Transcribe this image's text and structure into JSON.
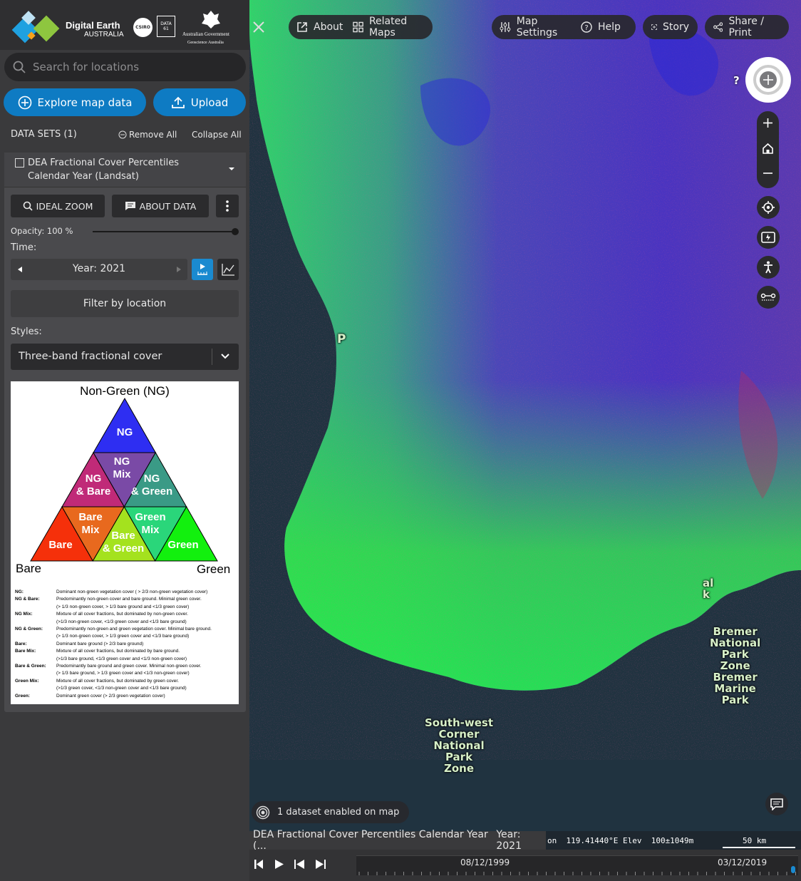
{
  "brand": {
    "name_line1": "Digital Earth",
    "name_line2": "AUSTRALIA",
    "csiro": "CSIRO",
    "data61": "DATA 61",
    "gov_line1": "Australian Government",
    "gov_line2": "Geoscience Australia"
  },
  "search": {
    "placeholder": "Search for locations"
  },
  "actions": {
    "explore": "Explore map data",
    "upload": "Upload"
  },
  "datasets_header": {
    "title": "DATA SETS (1)",
    "remove_all": "Remove All",
    "collapse_all": "Collapse All"
  },
  "dataset": {
    "title": "DEA Fractional Cover Percentiles Calendar Year (Landsat)",
    "ideal_zoom": "IDEAL ZOOM",
    "about_data": "ABOUT DATA",
    "opacity_label": "Opacity: 100 %",
    "opacity_value": 1.0,
    "time_label": "Time:",
    "year": "Year: 2021",
    "filter": "Filter by location",
    "styles_label": "Styles:",
    "style_value": "Three-band fractional cover"
  },
  "legend": {
    "title": "Non-Green (NG)",
    "corner_left": "Bare",
    "corner_right": "Green",
    "cells": {
      "ng": "NG",
      "ng_mix": "NG\nMix",
      "ng_bare": "NG\n& Bare",
      "ng_green": "NG\n& Green",
      "bare_mix": "Bare\nMix",
      "green_mix": "Green\nMix",
      "bare": "Bare",
      "bare_green": "Bare\n& Green",
      "green": "Green"
    },
    "colors": {
      "ng": "#2e2ef2",
      "ng_mix": "#7a4aa6",
      "ng_bare": "#c02a78",
      "ng_green": "#3a9a86",
      "bare_mix": "#e8691e",
      "green_mix": "#2ad67a",
      "bare": "#f5300a",
      "bare_green": "#a4e21e",
      "green": "#12f00e"
    },
    "definitions": [
      {
        "term": "NG:",
        "def": "Dominant non-green vegetation cover ( > 2/3 non-green vegetation cover)"
      },
      {
        "term": "NG & Bare:",
        "def": "Predominantly non-green cover and bare ground. Minimal green cover.\n(> 1/3 non-green cover, > 1/3 bare ground and <1/3 green cover)"
      },
      {
        "term": "NG Mix:",
        "def": "Mixture of all cover fractions, but dominated by non-green cover.\n(>1/3 non-green cover, <1/3 green cover and <1/3 bare ground)"
      },
      {
        "term": "NG & Green:",
        "def": "Predominantly non-green and green vegetation cover. Minimal bare ground.\n(> 1/3 non-green cover, > 1/3 green cover and <1/3 bare ground)"
      },
      {
        "term": "Bare:",
        "def": "Dominant bare ground (> 2/3 bare ground)"
      },
      {
        "term": "Bare Mix:",
        "def": "Mixture of all cover fractions, but dominated by bare ground.\n(>1/3 bare ground, <1/3 green cover and <1/3 non-green cover)"
      },
      {
        "term": "Bare & Green:",
        "def": "Predominantly bare ground and green cover. Minimal non-green cover.\n(> 1/3 bare ground, > 1/3 green cover and <1/3 non-green cover)"
      },
      {
        "term": "Green Mix:",
        "def": "Mixture of all cover fractions, but dominated by green cover.\n(>1/3 green cover, <1/3 non-green cover and <1/3 bare ground)"
      },
      {
        "term": "Green:",
        "def": " Dominant green cover (> 2/3 green vegetation cover)"
      }
    ]
  },
  "map_toolbar": {
    "about": "About",
    "related": "Related Maps",
    "settings": "Map Settings",
    "help": "Help",
    "story": "Story",
    "share": "Share / Print"
  },
  "map": {
    "labels": {
      "sw": "South-west\nCorner\nNational\nPark\nZone",
      "bremer": "Bremer\nNational\nPark\nZone\nBremer\nMarine\nPark",
      "p": "P",
      "al": "al\nk"
    },
    "compass_q": "?",
    "datasets_enabled": "1 dataset enabled on map",
    "bottom_title": "DEA Fractional Cover Percentiles Calendar Year (...",
    "bottom_year": "Year: 2021",
    "coords": "on  119.41440°E Elev  100±1049m",
    "scale": "50 km",
    "timeline": {
      "start": "08/12/1999",
      "end": "03/12/2019"
    }
  },
  "colors": {
    "accent": "#0e7bc3",
    "panel": "#3a3a3c"
  }
}
